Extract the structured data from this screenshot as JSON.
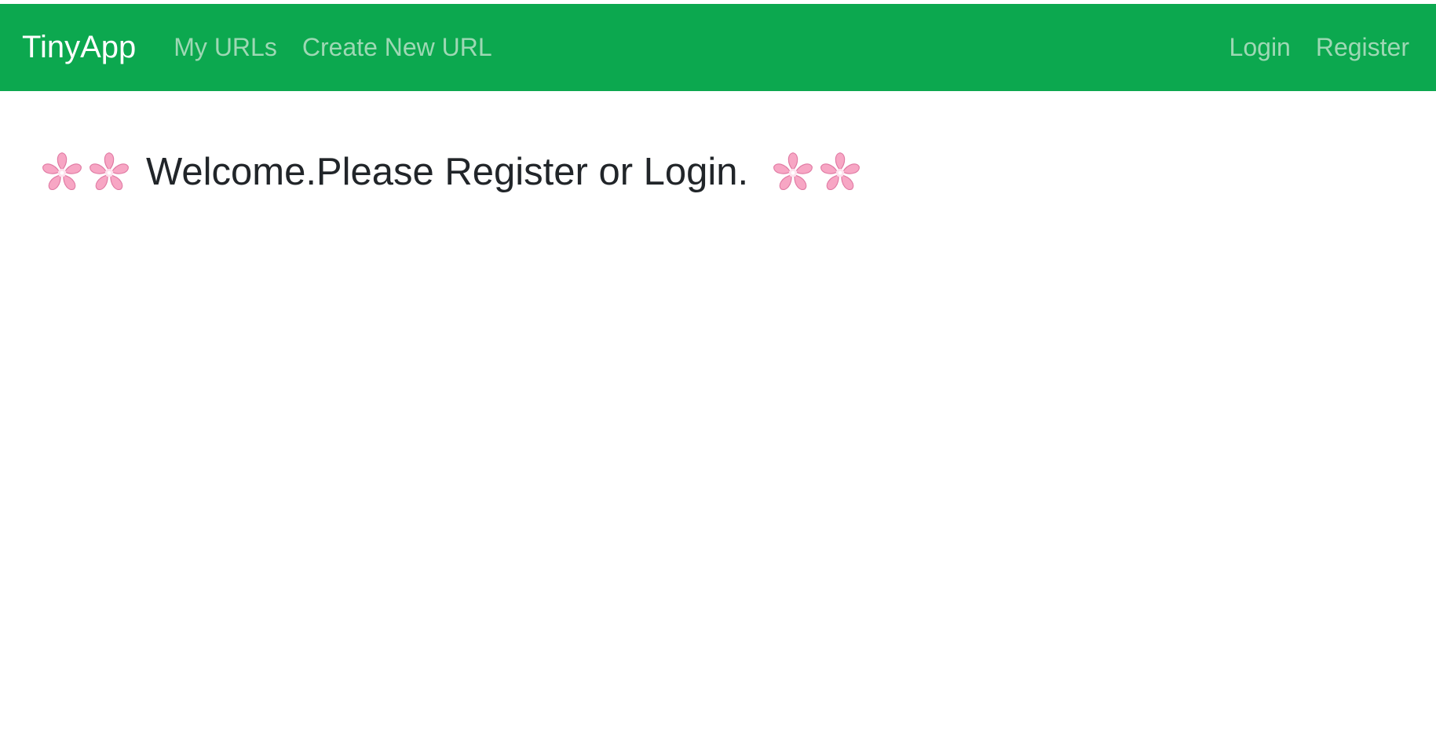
{
  "navbar": {
    "brand": "TinyApp",
    "links_left": [
      "My URLs",
      "Create New URL"
    ],
    "links_right": [
      "Login",
      "Register"
    ],
    "background_color": "#0ca84f",
    "link_color": "#9ed8b4",
    "brand_color": "#ffffff"
  },
  "main": {
    "welcome_message": "Welcome.Please Register or Login.",
    "decoration_icon": "cherry-blossom-icon",
    "decoration_color": "#f48fb1"
  }
}
